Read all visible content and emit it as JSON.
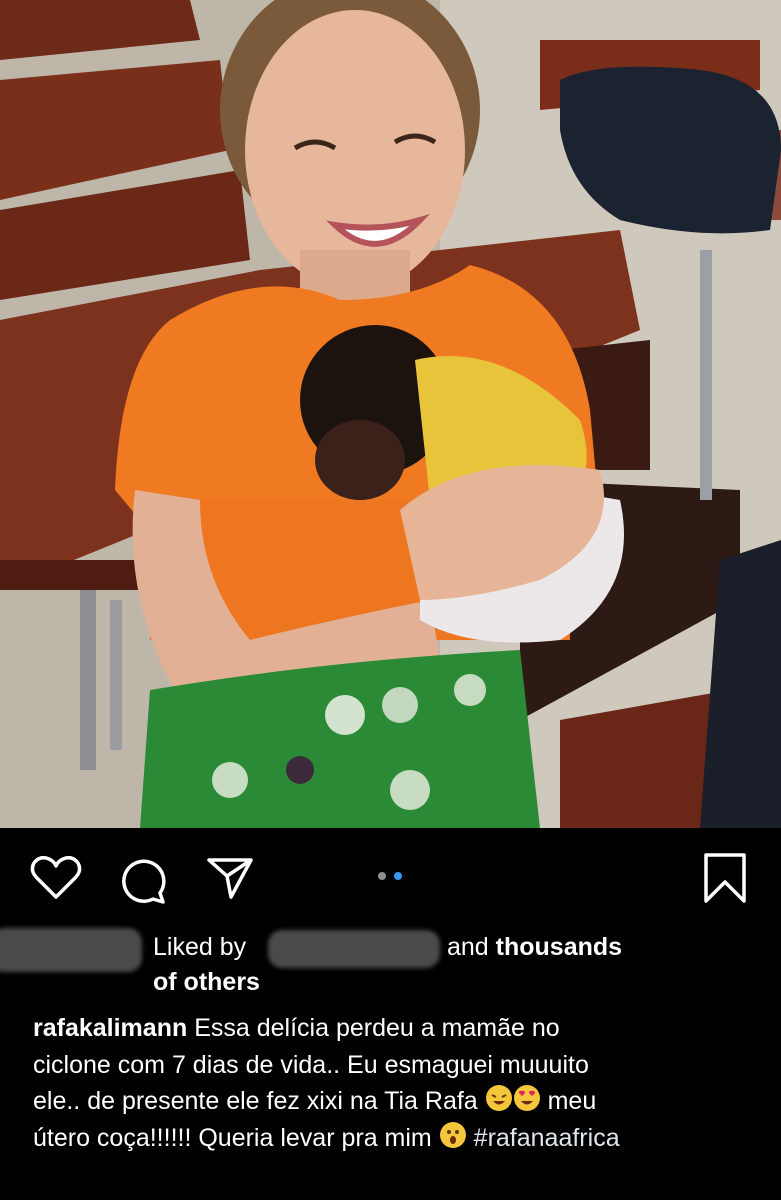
{
  "post": {
    "carousel": {
      "count": 2,
      "active_index": 2
    },
    "likes": {
      "prefix": "Liked by",
      "conjunction": "and",
      "suffix": "thousands",
      "line2": "of others"
    },
    "caption": {
      "username": "rafakalimann",
      "line1_text": "Essa delícia perdeu a mamãe no",
      "line2_text": "ciclone com 7 dias de vida.. Eu esmaguei muuuito",
      "line3_text": "ele.. de presente ele fez xixi na Tia Rafa",
      "line3_after_emoji": "meu",
      "line4_text": "útero coça!!!!!! Queria levar pra mim",
      "hashtag": "#rafanaafrica"
    },
    "icons": [
      "heart-icon",
      "comment-icon",
      "share-icon",
      "bookmark-icon"
    ],
    "colors": {
      "background": "#000000",
      "text": "#ffffff",
      "carousel_active": "#3897f0",
      "carousel_inactive": "#8e8e8e"
    }
  }
}
